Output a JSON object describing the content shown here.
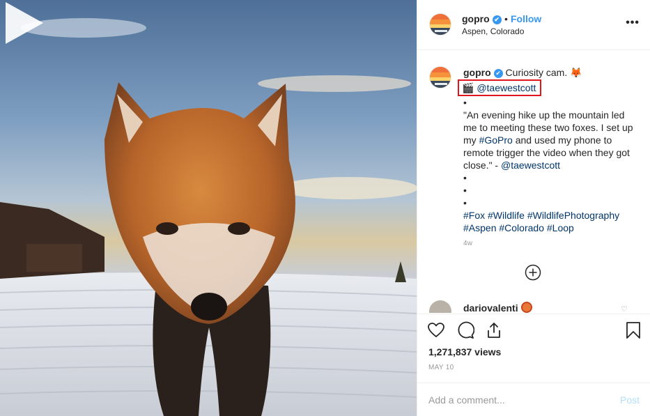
{
  "header": {
    "username": "gopro",
    "verified_glyph": "✔",
    "separator": "•",
    "follow_label": "Follow",
    "location": "Aspen, Colorado",
    "more_label": "•••"
  },
  "caption": {
    "username": "gopro",
    "text_intro": "Curiosity cam. 🦊",
    "clapper": "🎬",
    "mention": "@taewestcott",
    "bullet1": "•",
    "quote": "\"An evening hike up the mountain led me to meeting these two foxes. I set up my ",
    "hashtag_gopro": "#GoPro",
    "quote_end": " and used my phone to remote trigger the video when they got close.\" - ",
    "mention2": "@taewestcott",
    "bullet2": "•",
    "bullet3": "•",
    "bullet4": "•",
    "hashtags": [
      "#Fox",
      "#Wildlife",
      "#WildlifePhotography",
      "#Aspen",
      "#Colorado",
      "#Loop"
    ],
    "time_ago": "4w"
  },
  "comment": {
    "username": "dariovalenti"
  },
  "actions": {
    "icons": [
      "heart-icon",
      "comment-icon",
      "share-icon",
      "bookmark-icon"
    ],
    "views": "1,271,837 views",
    "date": "MAY 10"
  },
  "comment_bar": {
    "placeholder": "Add a comment...",
    "post_label": "Post"
  },
  "colors": {
    "accent": "#3897f0",
    "link": "#003569",
    "highlight_box": "#e0161d",
    "post_disabled": "#b2dffc"
  }
}
